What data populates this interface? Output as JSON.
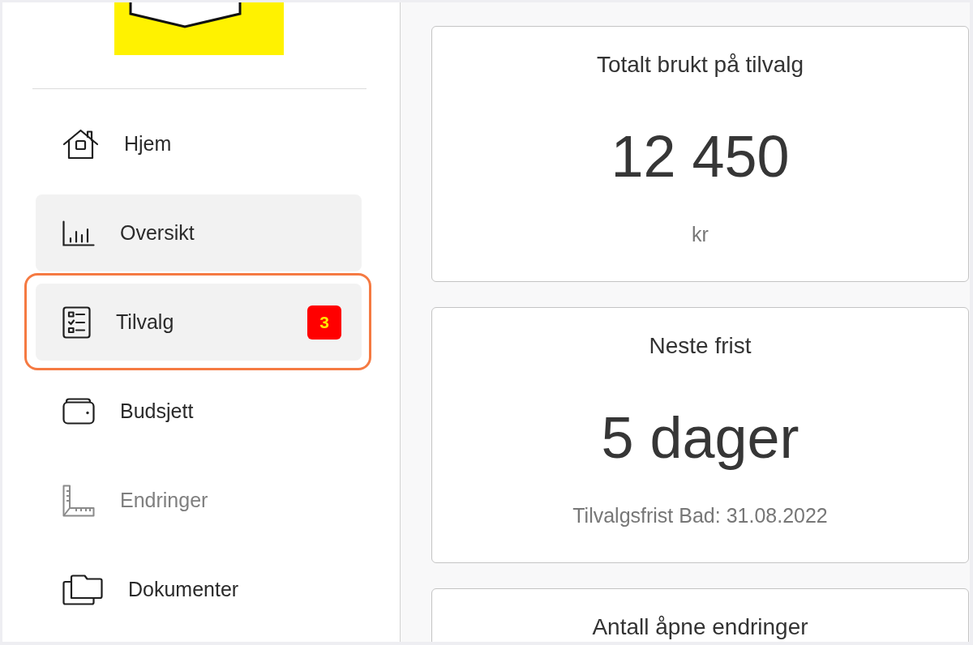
{
  "sidebar": {
    "items": [
      {
        "label": "Hjem",
        "selected": false,
        "disabled": false,
        "outlined": false
      },
      {
        "label": "Oversikt",
        "selected": true,
        "disabled": false,
        "outlined": false
      },
      {
        "label": "Tilvalg",
        "selected": true,
        "disabled": false,
        "outlined": true,
        "badge": "3"
      },
      {
        "label": "Budsjett",
        "selected": false,
        "disabled": false,
        "outlined": false
      },
      {
        "label": "Endringer",
        "selected": false,
        "disabled": true,
        "outlined": false
      },
      {
        "label": "Dokumenter",
        "selected": false,
        "disabled": false,
        "outlined": false
      }
    ]
  },
  "cards": [
    {
      "title": "Totalt brukt på tilvalg",
      "value": "12 450",
      "caption": "kr"
    },
    {
      "title": "Neste frist",
      "value": "5 dager",
      "caption": "Tilvalgsfrist Bad: 31.08.2022"
    },
    {
      "title": "Antall åpne endringer"
    }
  ]
}
